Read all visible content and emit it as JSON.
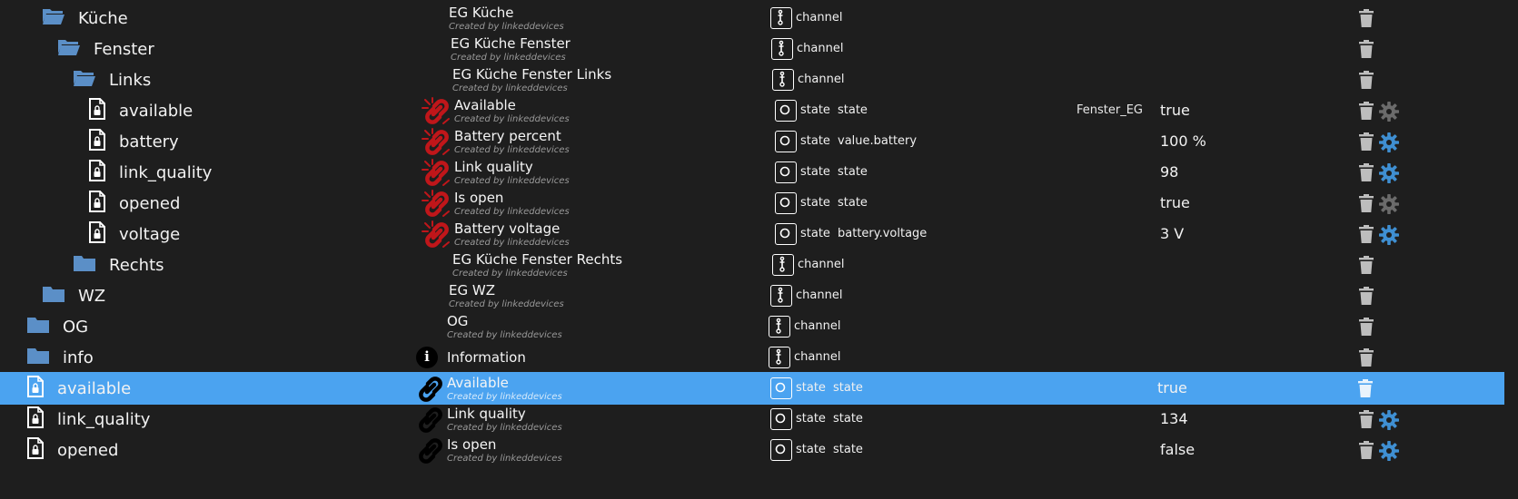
{
  "colors": {
    "folder": "#5b8fc7",
    "link_red": "#c0161a",
    "gear_active": "#3f8fd2",
    "gear_inactive": "#6b6b6b",
    "selected": "#4ba3f0"
  },
  "rows": [
    {
      "icon": "folder-open",
      "label": "Küche",
      "indent": 0,
      "title": "EG Küche",
      "subtitle": "Created by linkeddevices",
      "type": "channel",
      "role": "",
      "room": "",
      "value": "",
      "obj": "plain",
      "gear": "none"
    },
    {
      "icon": "folder-open",
      "label": "Fenster",
      "indent": 1,
      "title": "EG Küche Fenster",
      "subtitle": "Created by linkeddevices",
      "type": "channel",
      "role": "",
      "room": "",
      "value": "",
      "obj": "plain",
      "gear": "none"
    },
    {
      "icon": "folder-open",
      "label": "Links",
      "indent": 2,
      "title": "EG Küche Fenster Links",
      "subtitle": "Created by linkeddevices",
      "type": "channel",
      "role": "",
      "room": "",
      "value": "",
      "obj": "plain",
      "gear": "none"
    },
    {
      "icon": "file",
      "label": "available",
      "indent": 3,
      "title": "Available",
      "subtitle": "Created by linkeddevices",
      "type": "state",
      "role": "state",
      "room": "Fenster_EG",
      "value": "true",
      "obj": "link-broken",
      "gear": "inactive"
    },
    {
      "icon": "file",
      "label": "battery",
      "indent": 3,
      "title": "Battery percent",
      "subtitle": "Created by linkeddevices",
      "type": "state",
      "role": "value.battery",
      "room": "",
      "value": "100 %",
      "obj": "link-broken",
      "gear": "active"
    },
    {
      "icon": "file",
      "label": "link_quality",
      "indent": 3,
      "title": "Link quality",
      "subtitle": "Created by linkeddevices",
      "type": "state",
      "role": "state",
      "room": "",
      "value": "98",
      "obj": "link-broken",
      "gear": "active"
    },
    {
      "icon": "file",
      "label": "opened",
      "indent": 3,
      "title": "Is open",
      "subtitle": "Created by linkeddevices",
      "type": "state",
      "role": "state",
      "room": "",
      "value": "true",
      "obj": "link-broken",
      "gear": "inactive"
    },
    {
      "icon": "file",
      "label": "voltage",
      "indent": 3,
      "title": "Battery voltage",
      "subtitle": "Created by linkeddevices",
      "type": "state",
      "role": "battery.voltage",
      "room": "",
      "value": "3 V",
      "obj": "link-broken",
      "gear": "active"
    },
    {
      "icon": "folder",
      "label": "Rechts",
      "indent": 2,
      "title": "EG Küche Fenster Rechts",
      "subtitle": "Created by linkeddevices",
      "type": "channel",
      "role": "",
      "room": "",
      "value": "",
      "obj": "plain",
      "gear": "none"
    },
    {
      "icon": "folder",
      "label": "WZ",
      "indent": 0,
      "title": "EG WZ",
      "subtitle": "Created by linkeddevices",
      "type": "channel",
      "role": "",
      "room": "",
      "value": "",
      "obj": "plain",
      "gear": "none"
    },
    {
      "icon": "folder",
      "label": "OG",
      "indent": -1,
      "title": "OG",
      "subtitle": "Created by linkeddevices",
      "type": "channel",
      "role": "",
      "room": "",
      "value": "",
      "obj": "plain",
      "gear": "none"
    },
    {
      "icon": "folder",
      "label": "info",
      "indent": -1,
      "title": "Information",
      "subtitle": "",
      "type": "channel",
      "role": "",
      "room": "",
      "value": "",
      "obj": "info",
      "gear": "none"
    },
    {
      "icon": "file",
      "label": "available",
      "indent": -1,
      "title": "Available",
      "subtitle": "Created by linkeddevices",
      "type": "state",
      "role": "state",
      "room": "",
      "value": "true",
      "obj": "link",
      "gear": "none",
      "selected": true
    },
    {
      "icon": "file",
      "label": "link_quality",
      "indent": -1,
      "title": "Link quality",
      "subtitle": "Created by linkeddevices",
      "type": "state",
      "role": "state",
      "room": "",
      "value": "134",
      "obj": "link",
      "gear": "active"
    },
    {
      "icon": "file",
      "label": "opened",
      "indent": -1,
      "title": "Is open",
      "subtitle": "Created by linkeddevices",
      "type": "state",
      "role": "state",
      "room": "",
      "value": "false",
      "obj": "link",
      "gear": "active"
    }
  ]
}
